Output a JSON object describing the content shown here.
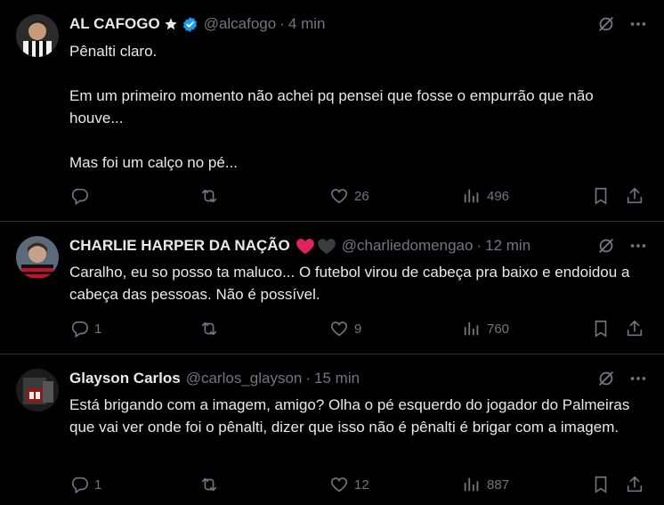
{
  "tweets": [
    {
      "name": "AL CAFOGO",
      "handle": "@alcafogo",
      "separator": "·",
      "time": "4 min",
      "text": "Pênalti claro.\n\nEm um primeiro momento não achei pq pensei que fosse o empurrão que não houve...\n\nMas foi um calço no pé...",
      "replies": "",
      "retweets": "",
      "likes": "26",
      "views": "496"
    },
    {
      "name": "CHARLIE HARPER DA NAÇÃO",
      "handle": "@charliedomengao",
      "separator": "·",
      "time": "12 min",
      "text": "Caralho, eu so posso ta maluco... O futebol virou de cabeça pra baixo e endoidou a cabeça das pessoas. Não é possível.",
      "replies": "1",
      "retweets": "",
      "likes": "9",
      "views": "760"
    },
    {
      "name": "Glayson Carlos",
      "handle": "@carlos_glayson",
      "separator": "·",
      "time": "15 min",
      "text": "Está brigando com a imagem, amigo? Olha o pé esquerdo do jogador do Palmeiras que vai ver onde foi o pênalti, dizer que isso não é pênalti é brigar com a imagem.",
      "replies": "1",
      "retweets": "",
      "likes": "12",
      "views": "887"
    }
  ],
  "colors": {
    "background": "#000000",
    "text": "#e7e9ea",
    "muted": "#71767b",
    "divider": "#2f3336",
    "verified": "#1d9bf0",
    "heart_red": "#e0245e"
  }
}
